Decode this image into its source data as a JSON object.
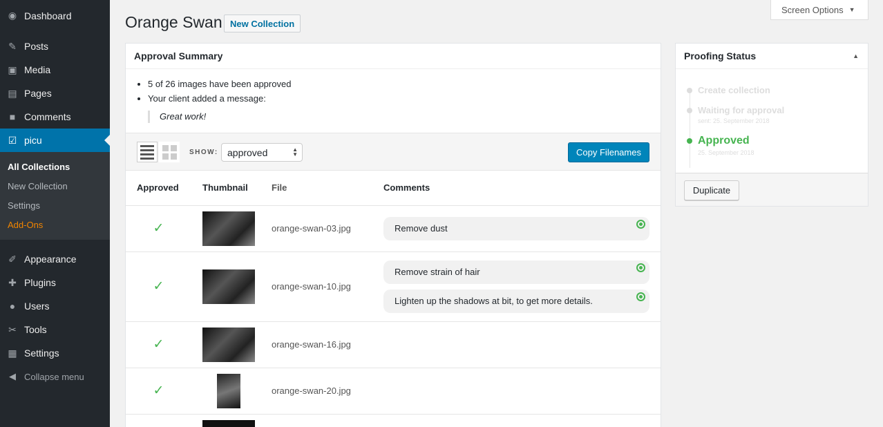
{
  "sidebar": {
    "items_top": [
      {
        "label": "Dashboard",
        "icon": "dashboard-icon",
        "glyph": "◉"
      },
      {
        "label": "Posts",
        "icon": "pin-icon",
        "glyph": "✎"
      },
      {
        "label": "Media",
        "icon": "media-icon",
        "glyph": "▣"
      },
      {
        "label": "Pages",
        "icon": "pages-icon",
        "glyph": "▤"
      },
      {
        "label": "Comments",
        "icon": "comments-icon",
        "glyph": "■"
      }
    ],
    "active": {
      "label": "picu",
      "icon": "picu-icon",
      "glyph": "☑"
    },
    "submenu": [
      "All Collections",
      "New Collection",
      "Settings",
      "Add-Ons"
    ],
    "items_bottom": [
      {
        "label": "Appearance",
        "icon": "paintbrush-icon",
        "glyph": "✐"
      },
      {
        "label": "Plugins",
        "icon": "plugin-icon",
        "glyph": "✚"
      },
      {
        "label": "Users",
        "icon": "users-icon",
        "glyph": "●"
      },
      {
        "label": "Tools",
        "icon": "wrench-icon",
        "glyph": "✂"
      },
      {
        "label": "Settings",
        "icon": "settings-icon",
        "glyph": "▦"
      }
    ],
    "collapse": {
      "label": "Collapse menu",
      "glyph": "◀"
    }
  },
  "header": {
    "title": "Orange Swan",
    "action": "New Collection",
    "screen_options": "Screen Options"
  },
  "summary": {
    "title": "Approval Summary",
    "line1": "5 of 26 images have been approved",
    "line2": "Your client added a message:",
    "quote": "Great work!"
  },
  "toolbar": {
    "show_label": "SHOW:",
    "show_value": "approved",
    "copy_button": "Copy Filenames"
  },
  "table": {
    "headers": {
      "approved": "Approved",
      "thumbnail": "Thumbnail",
      "file": "File",
      "comments": "Comments"
    },
    "rows": [
      {
        "file": "orange-swan-03.jpg",
        "comments": [
          "Remove dust"
        ]
      },
      {
        "file": "orange-swan-10.jpg",
        "comments": [
          "Remove strain of hair",
          "Lighten up the shadows at bit, to get more details."
        ]
      },
      {
        "file": "orange-swan-16.jpg",
        "comments": []
      },
      {
        "file": "orange-swan-20.jpg",
        "comments": []
      }
    ]
  },
  "proofing": {
    "title": "Proofing Status",
    "steps": [
      {
        "label": "Create collection",
        "date": ""
      },
      {
        "label": "Waiting for approval",
        "date": "sent: 25. September 2018"
      },
      {
        "label": "Approved",
        "date": "25. September 2018"
      }
    ],
    "duplicate": "Duplicate"
  },
  "colors": {
    "accent": "#0073aa",
    "approved": "#46b450",
    "addons": "#f18500",
    "sidebar": "#23282d"
  }
}
